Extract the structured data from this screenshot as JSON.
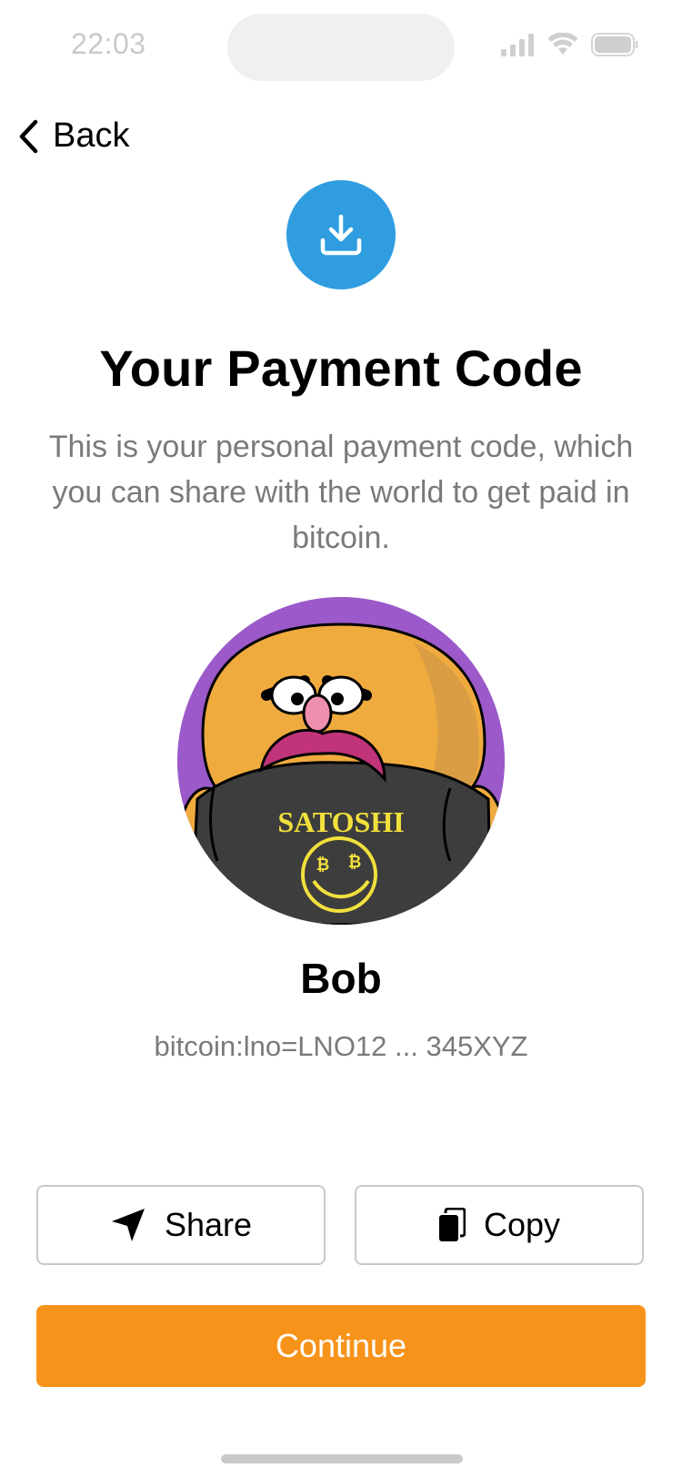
{
  "status_bar": {
    "time": "22:03"
  },
  "nav": {
    "back_label": "Back"
  },
  "header": {
    "icon": "receive-icon",
    "title": "Your Payment Code",
    "subtitle": "This is your personal payment code, which you can share with the world to get paid in bitcoin."
  },
  "profile": {
    "shirt_text": "SATOSHI",
    "name": "Bob",
    "payment_code": "bitcoin:lno=LNO12 ... 345XYZ"
  },
  "actions": {
    "share_label": "Share",
    "copy_label": "Copy",
    "continue_label": "Continue"
  },
  "colors": {
    "accent_blue": "#2f9de0",
    "accent_orange": "#f7931a",
    "avatar_bg": "#9b59c9"
  }
}
